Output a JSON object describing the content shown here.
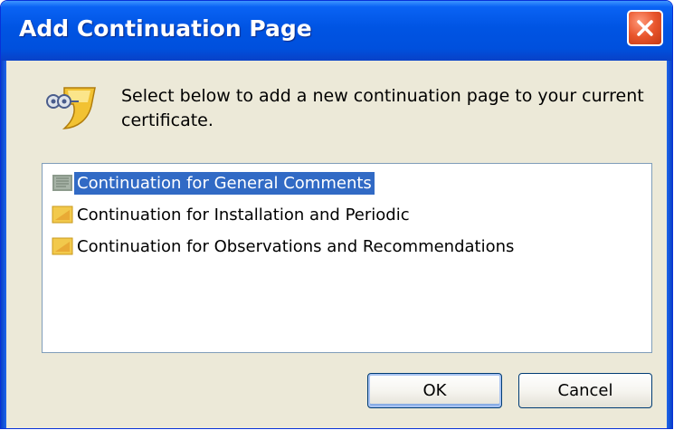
{
  "window": {
    "title": "Add Continuation Page"
  },
  "titlebar": {
    "close_icon": "close-x-icon"
  },
  "message": {
    "icon": "wizard-info-icon",
    "text": "Select below to add a new continuation page to your current certificate."
  },
  "list": {
    "items": [
      {
        "label": "Continuation for General Comments",
        "icon": "page-icon",
        "selected": true
      },
      {
        "label": "Continuation for Installation and Periodic",
        "icon": "page-icon",
        "selected": false
      },
      {
        "label": "Continuation for Observations and Recommendations",
        "icon": "page-icon",
        "selected": false
      }
    ]
  },
  "buttons": {
    "ok_label": "OK",
    "cancel_label": "Cancel"
  },
  "colors": {
    "titlebar": "#0054e3",
    "dialog_bg": "#ece9d8",
    "selection": "#316ac5",
    "close_button": "#e8552c",
    "item_icon": "#f2c94c"
  }
}
